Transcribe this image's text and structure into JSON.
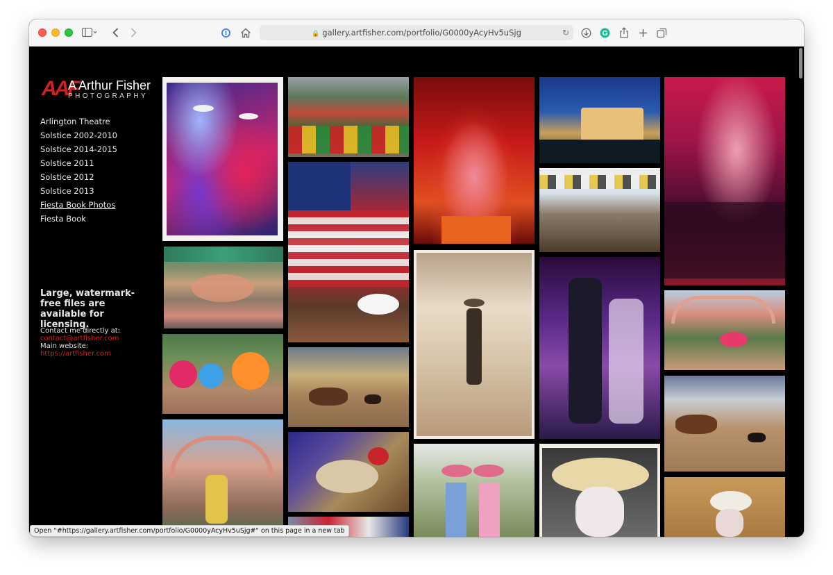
{
  "browser": {
    "url": "gallery.artfisher.com/portfolio/G0000yAcyHv5uSjg",
    "status_text": "Open \"#https://gallery.artfisher.com/portfolio/G0000yAcyHv5uSjg#\" on this page in a new tab",
    "icons": {
      "sidebar": "sidebar-icon",
      "back": "chevron-left-icon",
      "forward": "chevron-right-icon",
      "password": "password-manager-icon",
      "home": "home-icon",
      "lock": "lock-icon",
      "reload": "reload-icon",
      "download": "download-icon",
      "grammarly": "grammarly-icon",
      "share": "share-icon",
      "new_tab": "plus-icon",
      "tabs": "tab-overview-icon"
    }
  },
  "site": {
    "logo_mark": "AAF",
    "logo_name": "A Arthur Fisher",
    "logo_sub": "PHOTOGRAPHY",
    "nav": [
      {
        "label": "Arlington Theatre"
      },
      {
        "label": "Solstice 2002-2010"
      },
      {
        "label": "Solstice 2014-2015"
      },
      {
        "label": "Solstice 2011"
      },
      {
        "label": "Solstice 2012"
      },
      {
        "label": "Solstice 2013"
      },
      {
        "label": "Fiesta Book Photos",
        "active": true
      },
      {
        "label": "Fiesta Book"
      }
    ],
    "licensing": "Large, watermark-free files are available for licensing.",
    "contact_label": "Contact me directly at:",
    "contact_email": "contact@artfisher.com",
    "website_label": "Main website:",
    "website_url": "https://artfisher.com"
  },
  "colors": {
    "accent_red": "#e21b1b",
    "page_bg": "#000000"
  },
  "gallery": {
    "photos": [
      {
        "name": "photo-folklorico-dancers-painted"
      },
      {
        "name": "photo-market-stage-crowd"
      },
      {
        "name": "photo-flamenco-dancer-red-dress"
      },
      {
        "name": "photo-courthouse-night"
      },
      {
        "name": "photo-dancers-group-red"
      },
      {
        "name": "photo-courtyard-crowd"
      },
      {
        "name": "photo-american-flags-parade"
      },
      {
        "name": "photo-street-fair-crowd"
      },
      {
        "name": "photo-dancers-colorful-skirts"
      },
      {
        "name": "photo-sepia-vaquero-boy"
      },
      {
        "name": "photo-mariachi-singer"
      },
      {
        "name": "photo-mission-courtyard-dancer"
      },
      {
        "name": "photo-rodeo-calf-roping"
      },
      {
        "name": "photo-rodeo-tie-down"
      },
      {
        "name": "photo-mission-dancer-arms-up"
      },
      {
        "name": "photo-mutton-busting"
      },
      {
        "name": "photo-cowgirls-pink-hats"
      },
      {
        "name": "photo-rodeo-clown"
      },
      {
        "name": "photo-rodeo-clown-action"
      },
      {
        "name": "photo-parade-flags-bottom"
      }
    ]
  }
}
